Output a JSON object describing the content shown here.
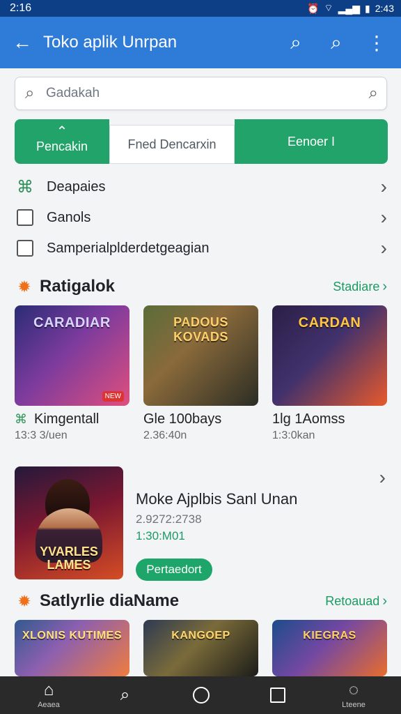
{
  "status_bar": {
    "time": "2:16",
    "battery_text": "2:43"
  },
  "app_bar": {
    "title": "Toko aplik Unrpan",
    "back_icon": "arrow-left-icon",
    "action_icons": [
      "search-icon",
      "search-icon",
      "more-vert-icon"
    ]
  },
  "search": {
    "placeholder": "Gadakah"
  },
  "segments": [
    {
      "label": "Pencakin",
      "selected": false
    },
    {
      "label": "Fned Dencarxin",
      "selected": true
    },
    {
      "label": "Eenoer I",
      "selected": false
    }
  ],
  "list": [
    {
      "label": "Deapaies",
      "lead": "network-icon"
    },
    {
      "label": "Ganols",
      "lead": "checkbox"
    },
    {
      "label": "Samperialplderdetgeagian",
      "lead": "checkbox"
    }
  ],
  "section1": {
    "title": "Ratigalok",
    "link": "Stadiare"
  },
  "games1": [
    {
      "title": "Kimgentall",
      "meta": "13:3 3/uen",
      "art_text": "CARADIAR",
      "accent": "#2f2b6d",
      "icon": "network-icon"
    },
    {
      "title": "Gle 100bays",
      "meta": "2.36:40n",
      "art_text": "PADOUS KOVADS",
      "accent": "#4b5642",
      "icon": ""
    },
    {
      "title": "1lg 1Aomss",
      "meta": "1:3:0kan",
      "art_text": "CARDAN",
      "accent": "#31214a",
      "icon": ""
    }
  ],
  "feature": {
    "title": "Moke Ajplbis Sanl Unan",
    "meta1": "2.9272:2738",
    "meta2": "1:30:M01",
    "button": "Pertaedort",
    "art_text": "YVARLES LAMES"
  },
  "section2": {
    "title": "Satlyrlie diaName",
    "link": "Retoauad"
  },
  "games2": [
    {
      "title": "",
      "meta": "",
      "art_text": "XLONIS KUTIMES",
      "accent": "#3d4c7b"
    },
    {
      "title": "",
      "meta": "",
      "art_text": "KANGOEP",
      "accent": "#5a4f2d"
    },
    {
      "title": "",
      "meta": "",
      "art_text": "KIEGRAS",
      "accent": "#1e446f"
    }
  ],
  "bottom_nav": [
    {
      "label": "Aeaea",
      "icon": "home-icon"
    },
    {
      "label": "",
      "icon": "search-icon"
    },
    {
      "label": "",
      "icon": "circle-icon"
    },
    {
      "label": "",
      "icon": "square-icon"
    },
    {
      "label": "Lteene",
      "icon": "person-icon"
    }
  ]
}
